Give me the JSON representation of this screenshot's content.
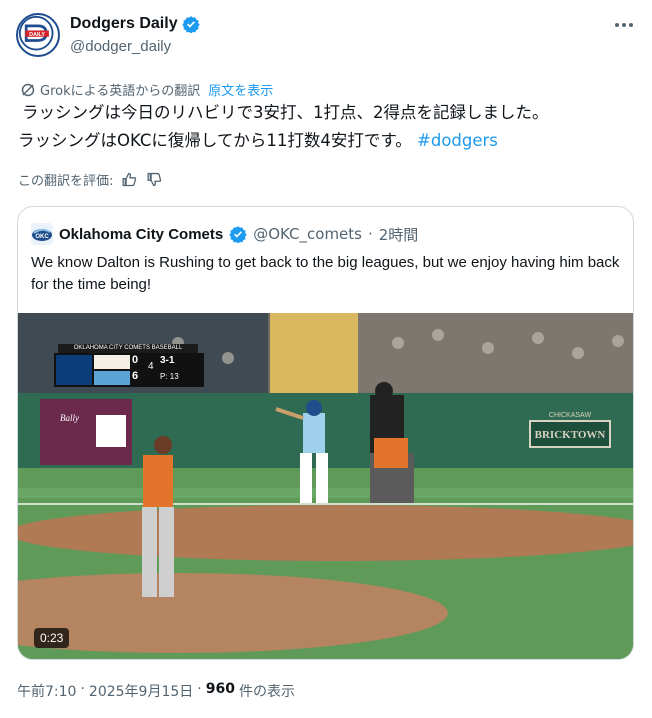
{
  "author": {
    "display_name": "Dodgers Daily",
    "handle": "@dodger_daily",
    "avatar_icon": "dodgers-daily-logo",
    "verified_icon": "verified-badge-icon"
  },
  "translation": {
    "notice": "Grokによる英語からの翻訳",
    "show_original": "原文を表示"
  },
  "tweet": {
    "line1": "ラッシングは今日のリハビリで3安打、1打点、2得点を記録しました。",
    "line2": "ラッシングはOKCに復帰してから11打数4安打です。",
    "hashtag": "#dodgers"
  },
  "rate": {
    "label": "この翻訳を評価:",
    "thumbs_up_icon": "thumbs-up-icon",
    "thumbs_down_icon": "thumbs-down-icon"
  },
  "quoted": {
    "display_name": "Oklahoma City Comets",
    "handle": "@OKC_comets",
    "separator": "·",
    "time_ago": "2時間",
    "text": "We know Dalton is Rushing to get back to the big leagues, but we enjoy having him back for the time being!",
    "video": {
      "duration": "0:23",
      "scorebug": {
        "title": "OKLAHOMA CITY COMETS BASEBALL",
        "away_score": "0",
        "home_score": "6",
        "inning": "4",
        "count": "3-1",
        "pitches": "P: 13"
      },
      "signage": {
        "bricktown_top": "CHICKASAW",
        "bricktown": "BRICKTOWN",
        "ad_brand": "Bally"
      }
    }
  },
  "footer": {
    "time": "午前7:10",
    "date": "2025年9月15日",
    "separator": "·",
    "views_count": "960",
    "views_label": "件の表示"
  },
  "colors": {
    "link": "#1d9bf0",
    "text": "#0f1419",
    "muted": "#536471",
    "border": "#cfd9de"
  }
}
